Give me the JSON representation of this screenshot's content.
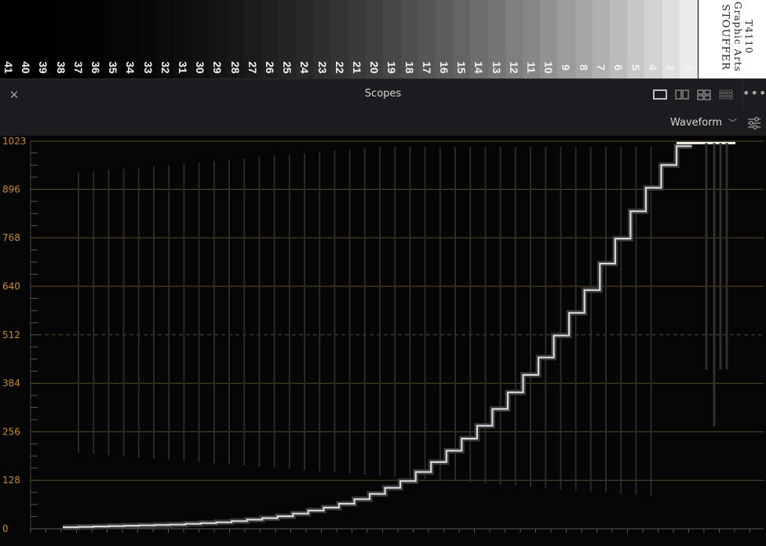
{
  "wedge": {
    "step_numbers": [
      "41",
      "40",
      "39",
      "38",
      "37",
      "36",
      "35",
      "34",
      "33",
      "32",
      "31",
      "30",
      "29",
      "28",
      "27",
      "26",
      "25",
      "24",
      "23",
      "22",
      "21",
      "20",
      "19",
      "18",
      "17",
      "16",
      "15",
      "14",
      "13",
      "12",
      "11",
      "10",
      "9",
      "8",
      "7",
      "6",
      "5",
      "4",
      "3",
      "2"
    ],
    "brand_lines": [
      "STOUFFER",
      "Graphic Arts",
      "T4110"
    ]
  },
  "panel": {
    "title": "Scopes",
    "close_icon": "close-icon",
    "more_icon": "more-options-icon",
    "layout_buttons": [
      "single-view-icon",
      "dual-view-icon",
      "quad-view-icon",
      "grid-view-icon"
    ]
  },
  "toolbar": {
    "mode_value": "Waveform",
    "settings_icon": "scope-settings-icon"
  },
  "scope": {
    "axis_ticks": [
      "1023",
      "896",
      "768",
      "640",
      "512",
      "384",
      "256",
      "128",
      "0"
    ],
    "axis_values": [
      1023,
      896,
      768,
      640,
      512,
      384,
      256,
      128,
      0
    ],
    "grid_color": "#5e4a2c",
    "label_color": "#c58a3e",
    "step_count": 41,
    "step_levels": [
      4,
      5,
      6,
      7,
      8,
      9,
      10,
      11,
      13,
      15,
      17,
      20,
      24,
      28,
      33,
      40,
      48,
      56,
      66,
      78,
      92,
      108,
      126,
      150,
      176,
      206,
      238,
      272,
      316,
      360,
      406,
      452,
      510,
      570,
      630,
      700,
      766,
      838,
      900,
      960,
      1010
    ]
  }
}
